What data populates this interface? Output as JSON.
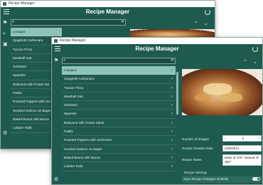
{
  "window_title": "Recipe Manager",
  "app_title": "Recipe Manager",
  "recipes": [
    "Lasagna",
    "Spaghetti Carbonara",
    "Tuscan Pizza",
    "Meatball Sub",
    "Schnitzel",
    "Spaetzle",
    "Bratwurst with Potato Salad",
    "Paella",
    "Roasted Peppers with Anchovies",
    "Smoked Salmon on Bagel",
    "Baked Beans with Bacon",
    "Lobster Rolls"
  ],
  "back_recipes": [
    "Lasagna",
    "Spaghetti Carbonara",
    "Tuscan Pizza",
    "Meatball Sub",
    "Schnitzel",
    "Spaetzle",
    "Bratwurst with Potato Sal",
    "Paella",
    "Roasted Peppers with Anc",
    "Smoked Salmon on Bagel",
    "Baked Beans with Bacon",
    "Lobster Rolls"
  ],
  "details": {
    "number_of_images_label": "Number of Images",
    "number_of_images_value": "3",
    "creation_date_label": "Recipe Creation Date",
    "creation_date_value": "2/28/2014",
    "notes_label": "Recipe Notes",
    "notes_value": "Bake at 375° instead of 350°",
    "settings_label": "Recipe Settings",
    "sync_label": "Sync Recipe Changes Globally"
  },
  "colors": {
    "app_bg": "#1f5a50",
    "selected_row": "#8ec3b8"
  },
  "icons": [
    "hamburger-icon",
    "refresh-icon",
    "search-icon",
    "flag-icon",
    "camera-icon",
    "gear-icon",
    "clear-icon",
    "chevron-right-icon",
    "chevron-up-icon",
    "chevron-down-icon"
  ]
}
